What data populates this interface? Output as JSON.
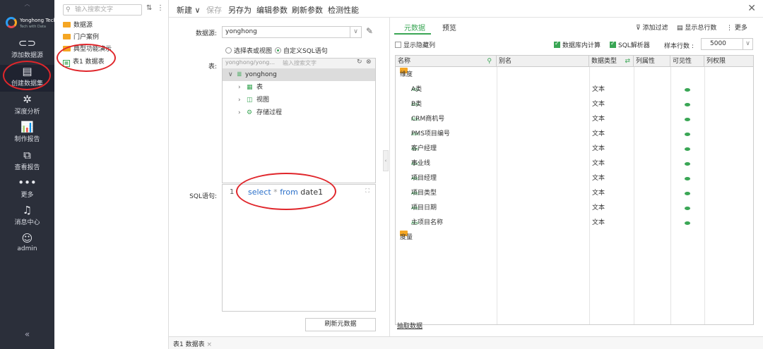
{
  "nav": {
    "logo_text": "Yonghong Tech",
    "logo_sub": "Tech with Data",
    "items": [
      {
        "label": "添加数据源",
        "icon": "link-icon"
      },
      {
        "label": "创建数据集",
        "icon": "dataset-icon"
      },
      {
        "label": "深度分析",
        "icon": "analysis-icon"
      },
      {
        "label": "制作报告",
        "icon": "chart-icon"
      },
      {
        "label": "查看报告",
        "icon": "view-report-icon"
      },
      {
        "label": "更多",
        "icon": "more-icon"
      },
      {
        "label": "消息中心",
        "icon": "bell-icon"
      },
      {
        "label": "admin",
        "icon": "user-icon"
      }
    ],
    "collapse": "«"
  },
  "tree": {
    "search_placeholder": "输入搜索文字",
    "items": [
      "数据源",
      "门户案例",
      "典型功能演示",
      "表1 数据表"
    ]
  },
  "toolbar": {
    "new": "新建",
    "save": "保存",
    "save_as": "另存为",
    "edit_params": "编辑参数",
    "refresh_params": "刷新参数",
    "check_perf": "检测性能"
  },
  "form": {
    "datasource_label": "数据源:",
    "datasource_value": "yonghong",
    "radio_table": "选择表或视图",
    "radio_sql": "自定义SQL语句",
    "table_label": "表:",
    "table_path": "yonghong/yong...",
    "table_search_placeholder": "输入搜索文字",
    "tree": {
      "root": "yonghong",
      "children": [
        "表",
        "视图",
        "存储过程"
      ]
    },
    "sql_label": "SQL语句:",
    "sql_line": "1",
    "sql_select": "select",
    "sql_star": " * ",
    "sql_from": "from",
    "sql_table": " date1",
    "refresh_button": "刷新元数据"
  },
  "right": {
    "tab_meta": "元数据",
    "tab_preview": "预览",
    "add_filter": "添加过滤",
    "show_total_rows": "显示总行数",
    "more": "更多",
    "show_hidden": "显示隐藏列",
    "db_calc": "数据库内计算",
    "sql_parser": "SQL解析器",
    "sample_rows_label": "样本行数 :",
    "sample_rows_value": "5000",
    "columns": [
      "名称",
      "别名",
      "数据类型",
      "列属性",
      "可见性",
      "列权限"
    ],
    "dimension_folder": "维度",
    "measure_folder": "度量",
    "rows": [
      {
        "name": "A类",
        "type": "文本"
      },
      {
        "name": "B类",
        "type": "文本"
      },
      {
        "name": "CRM商机号",
        "type": "文本"
      },
      {
        "name": "PMS项目编号",
        "type": "文本"
      },
      {
        "name": "客户经理",
        "type": "文本"
      },
      {
        "name": "事业线",
        "type": "文本"
      },
      {
        "name": "项目经理",
        "type": "文本"
      },
      {
        "name": "项目类型",
        "type": "文本"
      },
      {
        "name": "项目日期",
        "type": "文本"
      },
      {
        "name": "主项目名称",
        "type": "文本"
      }
    ],
    "extract_data": "抽取数据",
    "abc_tag": "Abc"
  },
  "bottom_tab": "表1 数据表"
}
